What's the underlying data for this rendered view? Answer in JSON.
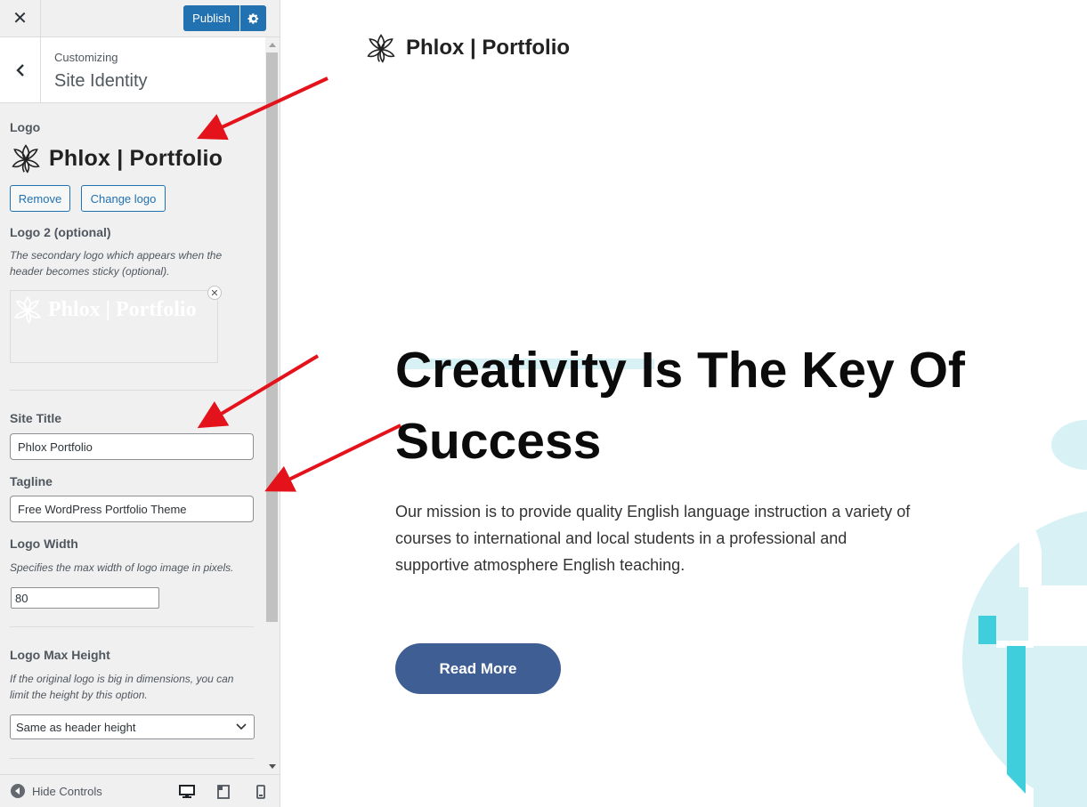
{
  "sidebar": {
    "close_glyph": "✕",
    "publish_label": "Publish",
    "customizing_label": "Customizing",
    "section_title": "Site Identity",
    "logo": {
      "label": "Logo",
      "preview_text": "Phlox | Portfolio",
      "remove_label": "Remove",
      "change_label": "Change logo"
    },
    "logo2": {
      "label": "Logo 2 (optional)",
      "description": "The secondary logo which appears when the header becomes sticky (optional).",
      "preview_text": "Phlox | Portfolio",
      "remove_glyph": "✕"
    },
    "site_title": {
      "label": "Site Title",
      "value": "Phlox Portfolio"
    },
    "tagline": {
      "label": "Tagline",
      "value": "Free WordPress Portfolio Theme"
    },
    "logo_width": {
      "label": "Logo Width",
      "description": "Specifies the max width of logo image in pixels.",
      "value": "80"
    },
    "logo_max_height": {
      "label": "Logo Max Height",
      "description": "If the original logo is big in dimensions, you can limit the height by this option.",
      "selected": "Same as header height"
    },
    "footer": {
      "hide_controls_label": "Hide Controls",
      "devices": [
        "desktop",
        "tablet",
        "mobile"
      ]
    }
  },
  "preview": {
    "site_logo_text": "Phlox | Portfolio",
    "hero_title": "Creativity Is The Key Of Success",
    "hero_body": "Our mission is to provide quality English language instruction a variety of courses to international and local students in a professional and supportive atmosphere English teaching.",
    "cta_label": "Read More"
  },
  "colors": {
    "accent": "#2271b1",
    "cta": "#3f5f94",
    "arrow": "#e4131b",
    "deco_light": "#d7f1f5",
    "deco_teal": "#3fcfdc"
  }
}
